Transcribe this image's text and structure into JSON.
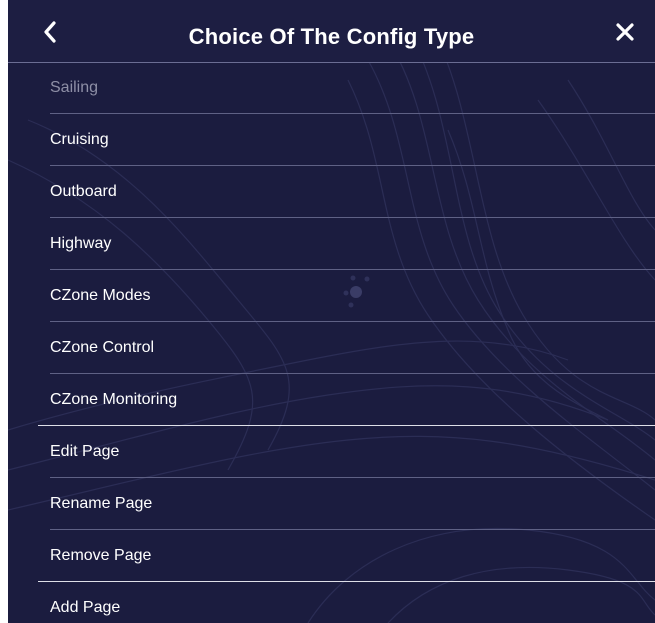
{
  "header": {
    "title": "Choice Of The Config Type",
    "back_icon": "chevron-left-icon",
    "close_icon": "close-icon"
  },
  "menu": {
    "items": [
      {
        "label": "Sailing",
        "enabled": false
      },
      {
        "label": "Cruising",
        "enabled": true
      },
      {
        "label": "Outboard",
        "enabled": true
      },
      {
        "label": "Highway",
        "enabled": true
      },
      {
        "label": "CZone Modes",
        "enabled": true
      },
      {
        "label": "CZone Control",
        "enabled": true
      },
      {
        "label": "CZone Monitoring",
        "enabled": true
      },
      {
        "label": "Edit Page",
        "enabled": true
      },
      {
        "label": "Rename Page",
        "enabled": true
      },
      {
        "label": "Remove Page",
        "enabled": true
      },
      {
        "label": "Add Page",
        "enabled": true
      }
    ]
  },
  "colors": {
    "background": "#1b1c3f",
    "text": "#ffffff",
    "disabled_text": "#8e8fa6",
    "separator": "#5f6185",
    "group_separator": "#dedfe8"
  }
}
